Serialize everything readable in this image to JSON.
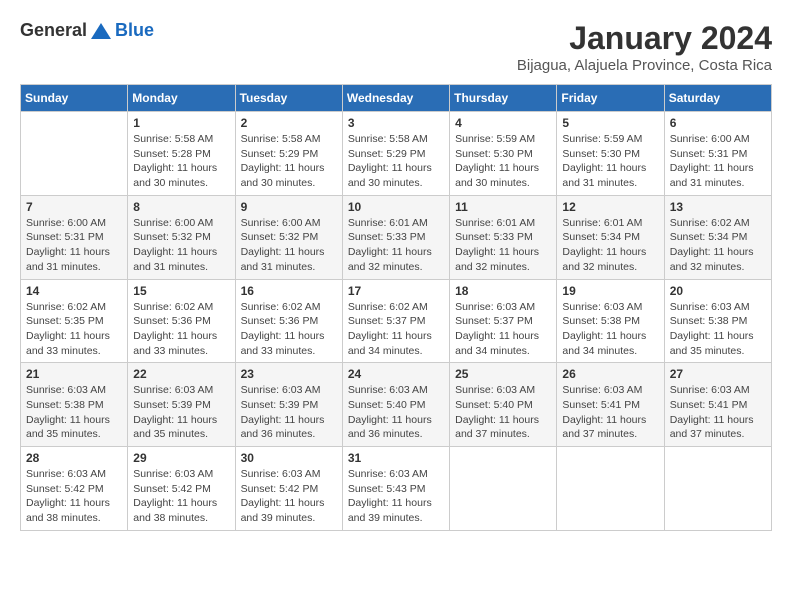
{
  "logo": {
    "general": "General",
    "blue": "Blue"
  },
  "title": "January 2024",
  "subtitle": "Bijagua, Alajuela Province, Costa Rica",
  "days_header": [
    "Sunday",
    "Monday",
    "Tuesday",
    "Wednesday",
    "Thursday",
    "Friday",
    "Saturday"
  ],
  "weeks": [
    [
      {
        "day": "",
        "info": ""
      },
      {
        "day": "1",
        "info": "Sunrise: 5:58 AM\nSunset: 5:28 PM\nDaylight: 11 hours\nand 30 minutes."
      },
      {
        "day": "2",
        "info": "Sunrise: 5:58 AM\nSunset: 5:29 PM\nDaylight: 11 hours\nand 30 minutes."
      },
      {
        "day": "3",
        "info": "Sunrise: 5:58 AM\nSunset: 5:29 PM\nDaylight: 11 hours\nand 30 minutes."
      },
      {
        "day": "4",
        "info": "Sunrise: 5:59 AM\nSunset: 5:30 PM\nDaylight: 11 hours\nand 30 minutes."
      },
      {
        "day": "5",
        "info": "Sunrise: 5:59 AM\nSunset: 5:30 PM\nDaylight: 11 hours\nand 31 minutes."
      },
      {
        "day": "6",
        "info": "Sunrise: 6:00 AM\nSunset: 5:31 PM\nDaylight: 11 hours\nand 31 minutes."
      }
    ],
    [
      {
        "day": "7",
        "info": "Sunrise: 6:00 AM\nSunset: 5:31 PM\nDaylight: 11 hours\nand 31 minutes."
      },
      {
        "day": "8",
        "info": "Sunrise: 6:00 AM\nSunset: 5:32 PM\nDaylight: 11 hours\nand 31 minutes."
      },
      {
        "day": "9",
        "info": "Sunrise: 6:00 AM\nSunset: 5:32 PM\nDaylight: 11 hours\nand 31 minutes."
      },
      {
        "day": "10",
        "info": "Sunrise: 6:01 AM\nSunset: 5:33 PM\nDaylight: 11 hours\nand 32 minutes."
      },
      {
        "day": "11",
        "info": "Sunrise: 6:01 AM\nSunset: 5:33 PM\nDaylight: 11 hours\nand 32 minutes."
      },
      {
        "day": "12",
        "info": "Sunrise: 6:01 AM\nSunset: 5:34 PM\nDaylight: 11 hours\nand 32 minutes."
      },
      {
        "day": "13",
        "info": "Sunrise: 6:02 AM\nSunset: 5:34 PM\nDaylight: 11 hours\nand 32 minutes."
      }
    ],
    [
      {
        "day": "14",
        "info": "Sunrise: 6:02 AM\nSunset: 5:35 PM\nDaylight: 11 hours\nand 33 minutes."
      },
      {
        "day": "15",
        "info": "Sunrise: 6:02 AM\nSunset: 5:36 PM\nDaylight: 11 hours\nand 33 minutes."
      },
      {
        "day": "16",
        "info": "Sunrise: 6:02 AM\nSunset: 5:36 PM\nDaylight: 11 hours\nand 33 minutes."
      },
      {
        "day": "17",
        "info": "Sunrise: 6:02 AM\nSunset: 5:37 PM\nDaylight: 11 hours\nand 34 minutes."
      },
      {
        "day": "18",
        "info": "Sunrise: 6:03 AM\nSunset: 5:37 PM\nDaylight: 11 hours\nand 34 minutes."
      },
      {
        "day": "19",
        "info": "Sunrise: 6:03 AM\nSunset: 5:38 PM\nDaylight: 11 hours\nand 34 minutes."
      },
      {
        "day": "20",
        "info": "Sunrise: 6:03 AM\nSunset: 5:38 PM\nDaylight: 11 hours\nand 35 minutes."
      }
    ],
    [
      {
        "day": "21",
        "info": "Sunrise: 6:03 AM\nSunset: 5:38 PM\nDaylight: 11 hours\nand 35 minutes."
      },
      {
        "day": "22",
        "info": "Sunrise: 6:03 AM\nSunset: 5:39 PM\nDaylight: 11 hours\nand 35 minutes."
      },
      {
        "day": "23",
        "info": "Sunrise: 6:03 AM\nSunset: 5:39 PM\nDaylight: 11 hours\nand 36 minutes."
      },
      {
        "day": "24",
        "info": "Sunrise: 6:03 AM\nSunset: 5:40 PM\nDaylight: 11 hours\nand 36 minutes."
      },
      {
        "day": "25",
        "info": "Sunrise: 6:03 AM\nSunset: 5:40 PM\nDaylight: 11 hours\nand 37 minutes."
      },
      {
        "day": "26",
        "info": "Sunrise: 6:03 AM\nSunset: 5:41 PM\nDaylight: 11 hours\nand 37 minutes."
      },
      {
        "day": "27",
        "info": "Sunrise: 6:03 AM\nSunset: 5:41 PM\nDaylight: 11 hours\nand 37 minutes."
      }
    ],
    [
      {
        "day": "28",
        "info": "Sunrise: 6:03 AM\nSunset: 5:42 PM\nDaylight: 11 hours\nand 38 minutes."
      },
      {
        "day": "29",
        "info": "Sunrise: 6:03 AM\nSunset: 5:42 PM\nDaylight: 11 hours\nand 38 minutes."
      },
      {
        "day": "30",
        "info": "Sunrise: 6:03 AM\nSunset: 5:42 PM\nDaylight: 11 hours\nand 39 minutes."
      },
      {
        "day": "31",
        "info": "Sunrise: 6:03 AM\nSunset: 5:43 PM\nDaylight: 11 hours\nand 39 minutes."
      },
      {
        "day": "",
        "info": ""
      },
      {
        "day": "",
        "info": ""
      },
      {
        "day": "",
        "info": ""
      }
    ]
  ]
}
